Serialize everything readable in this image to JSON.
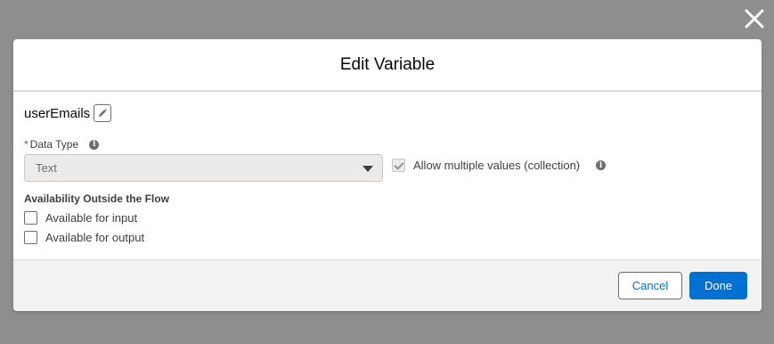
{
  "modal": {
    "title": "Edit Variable",
    "variable_name": "userEmails"
  },
  "form": {
    "data_type_label": "Data Type",
    "required_marker": "*",
    "data_type_value": "Text",
    "allow_multiple_label": "Allow multiple values (collection)",
    "allow_multiple_checked": true,
    "allow_multiple_disabled": true,
    "availability_heading": "Availability Outside the Flow",
    "available_input_label": "Available for input",
    "available_input_checked": false,
    "available_output_label": "Available for output",
    "available_output_checked": false
  },
  "footer": {
    "cancel_label": "Cancel",
    "done_label": "Done"
  },
  "icons": {
    "close": "close-icon",
    "edit": "pencil-icon",
    "info": "info-icon",
    "dropdown": "chevron-down-icon"
  },
  "colors": {
    "brand": "#0070d2",
    "required": "#c23934",
    "overlay": "#8e8e8e"
  }
}
